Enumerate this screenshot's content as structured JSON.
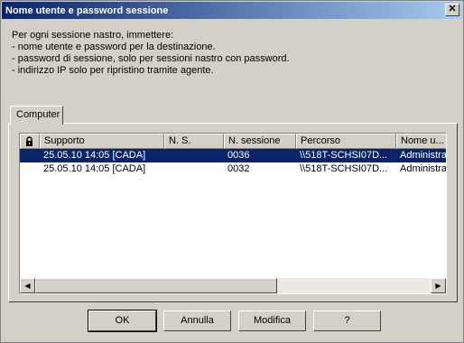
{
  "window": {
    "title": "Nome utente e password sessione",
    "close_glyph": "✕"
  },
  "instructions": [
    "Per ogni sessione nastro, immettere:",
    "- nome utente e password per la destinazione.",
    "- password di sessione, solo per sessioni nastro con password.",
    "- indirizzo IP solo per ripristino tramite agente."
  ],
  "tabs": [
    {
      "label": "Computer",
      "active": true
    }
  ],
  "table": {
    "columns": [
      "",
      "Supporto",
      "N. S.",
      "N. sessione",
      "Percorso",
      "Nome u..."
    ],
    "rows": [
      {
        "media": "25.05.10 14:05 [CADA]",
        "serial": "",
        "session": "0036",
        "path": "\\\\518T-SCHSI07D...",
        "user": "Administrat",
        "selected": true
      },
      {
        "media": "25.05.10 14:05 [CADA]",
        "serial": "",
        "session": "0032",
        "path": "\\\\518T-SCHSI07D...",
        "user": "Administrat",
        "selected": false
      }
    ]
  },
  "scrollbar": {
    "left_glyph": "◀",
    "right_glyph": "▶"
  },
  "buttons": {
    "ok": "OK",
    "cancel": "Annulla",
    "modify": "Modifica",
    "help": "?"
  },
  "colors": {
    "title_start": "#0a246a",
    "title_end": "#a6caf0",
    "selection": "#0a246a",
    "face": "#d4d0c8"
  }
}
